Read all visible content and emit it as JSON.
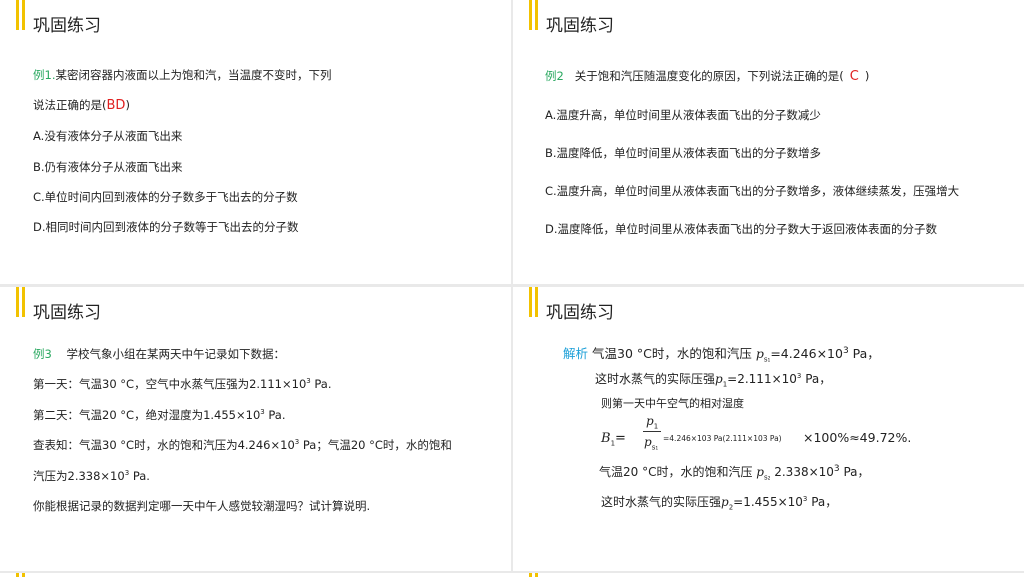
{
  "panel1": {
    "title": "巩固练习",
    "label": "例1.",
    "q_line1": "某密闭容器内液面以上为饱和汽，当温度不变时，下列",
    "q_line2": "说法正确的是(",
    "answer": "BD",
    "close": ")",
    "options": [
      "A.没有液体分子从液面飞出来",
      "B.仍有液体分子从液面飞出来",
      "C.单位时间内回到液体的分子数多于飞出去的分子数",
      "D.相同时间内回到液体的分子数等于飞出去的分子数"
    ]
  },
  "panel2": {
    "title": "巩固练习",
    "label": "例2",
    "question": "关于饱和汽压随温度变化的原因，下列说法正确的是(",
    "answer": "C",
    "close": ")",
    "options": [
      "A.温度升高，单位时间里从液体表面飞出的分子数减少",
      "B.温度降低，单位时间里从液体表面飞出的分子数增多",
      "C.温度升高，单位时间里从液体表面飞出的分子数增多，液体继续蒸发，压强增大",
      "D.温度降低，单位时间里从液体表面飞出的分子数大于返回液体表面的分子数"
    ]
  },
  "panel3": {
    "title": "巩固练习",
    "label": "例3",
    "question": "学校气象小组在某两天中午记录如下数据：",
    "day1_a": "第一天：气温30 °C，空气中水蒸气压强为2.111×10",
    "day1_exp": "3",
    "day1_b": " Pa.",
    "day2_a": "第二天：气温20 °C，绝对湿度为1.455×10",
    "day2_exp": "3",
    "day2_b": " Pa.",
    "known_a": "查表知：气温30 °C时，水的饱和汽压为4.246×10",
    "known_exp": "3",
    "known_b": " Pa；气温20 °C时，水的饱和",
    "known2_a": "汽压为2.338×10",
    "known2_exp": "3",
    "known2_b": " Pa.",
    "ask": "你能根据记录的数据判定哪一天中午人感觉较潮湿吗？试计算说明."
  },
  "panel4": {
    "title": "巩固练习",
    "label": "解析",
    "l1_a": "气温30 °C时，水的饱和汽压 ",
    "l1_ps": "p",
    "l1_pssub": "s₁",
    "l1_b": "=4.246×10",
    "l1_exp": "3",
    "l1_c": " Pa，",
    "l2_a": "这时水蒸气的实际压强",
    "l2_p": "p",
    "l2_sub": "1",
    "l2_b": "=2.111×10",
    "l2_exp": "3",
    "l2_c": " Pa，",
    "l3": "则第一天中午空气的相对湿度",
    "b1": "B",
    "b1_sub": "1",
    "eq": "=",
    "num": "p",
    "num_sub": "1",
    "den": "p",
    "den_sub": "s₁",
    "small_calc": "=4.246×103 Pa(2.111×103 Pa)",
    "result": "×100%≈49.72%.",
    "l5_a": "气温20 °C时，水的饱和汽压 ",
    "l5_ps": "p",
    "l5_pssub": "s₂",
    "l5_b": " 2.338×10",
    "l5_exp": "3",
    "l5_c": " Pa，",
    "l6_a": "这时水蒸气的实际压强",
    "l6_p": "p",
    "l6_sub": "2",
    "l6_b": "=1.455×10",
    "l6_exp": "3",
    "l6_c": " Pa，"
  },
  "colors": {
    "accent_bar": "#f2c200",
    "label_green": "#2aa860",
    "label_blue": "#1ea0d8",
    "answer_red": "#e02020"
  }
}
